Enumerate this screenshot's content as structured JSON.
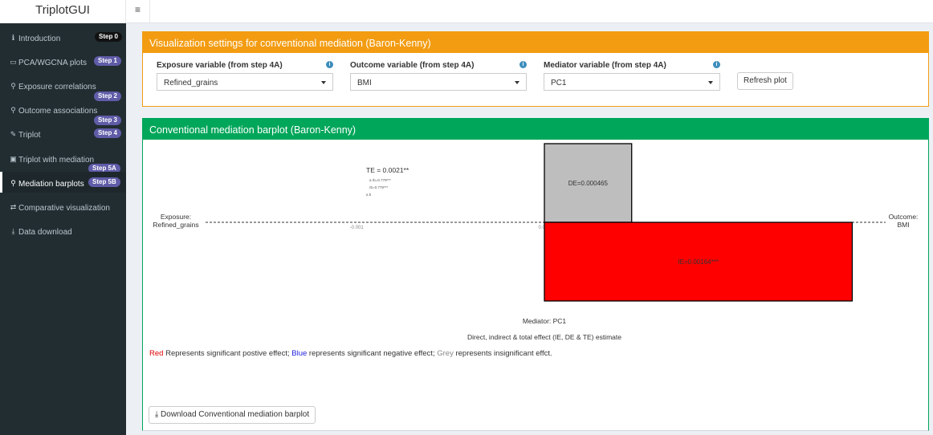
{
  "app": {
    "title": "TriplotGUI",
    "toggle_icon": "≡"
  },
  "sidebar": {
    "items": [
      {
        "label": "Introduction",
        "icon": "ℹ",
        "badges": [
          "Step 0"
        ],
        "active": false
      },
      {
        "label": "PCA/WGCNA plots",
        "icon": "▭",
        "badges": [
          "Step 1"
        ],
        "active": false
      },
      {
        "label": "Exposure correlations",
        "icon": "⚲",
        "badges": [
          "Step 2"
        ],
        "active": false
      },
      {
        "label": "Outcome associations",
        "icon": "⚲",
        "badges": [
          "Step 3"
        ],
        "active": false
      },
      {
        "label": "Triplot",
        "icon": "✎",
        "badges": [
          "Step 4"
        ],
        "active": false
      },
      {
        "label": "Triplot with mediation",
        "icon": "▣",
        "badges": [
          "Step 5A"
        ],
        "active": false
      },
      {
        "label": "Mediation barplots",
        "icon": "⚲",
        "badges": [
          "Step 5B"
        ],
        "active": true
      },
      {
        "label": "Comparative visualization",
        "icon": "⇄",
        "badges": [],
        "active": false
      },
      {
        "label": "Data download",
        "icon": "⤓",
        "badges": [],
        "active": false
      }
    ]
  },
  "settings": {
    "title": "Visualization settings for conventional mediation (Baron-Kenny)",
    "exposure": {
      "label": "Exposure variable (from step 4A)",
      "value": "Refined_grains"
    },
    "outcome": {
      "label": "Outcome variable (from step 4A)",
      "value": "BMI"
    },
    "mediator": {
      "label": "Mediator variable (from step 4A)",
      "value": "PC1"
    },
    "refresh_label": "Refresh plot",
    "info_icon": "i"
  },
  "barplot": {
    "title": "Conventional mediation barplot (Baron-Kenny)",
    "legend": {
      "red": "Red",
      "red_text": " Represents significant postive effect; ",
      "blue": "Blue",
      "blue_text": " represents significant negative effect; ",
      "grey": "Grey",
      "grey_text": " represents insignificant effct."
    },
    "download_label": "Download Conventional mediation barplot",
    "download_icon": "⤓"
  },
  "chart_data": {
    "type": "bar",
    "exposure_label": [
      "Exposure:",
      "Refined_grains"
    ],
    "outcome_label": [
      "Outcome:",
      "BMI"
    ],
    "mediator_label": "Mediator: PC1",
    "xlabel": "Direct, indirect & total effect (IE, DE & TE) estimate",
    "x_ticks": [
      {
        "value": -0.001,
        "label": "-0.001"
      },
      {
        "value": 0,
        "label": "0.000"
      },
      {
        "value": 0.001,
        "label": "0.001"
      }
    ],
    "bars": [
      {
        "name": "DE",
        "start": 0,
        "end": 0.000465,
        "label": "DE=0.000465",
        "color": "#bebebe",
        "side": "above"
      },
      {
        "name": "IE",
        "start": 0,
        "end": 0.00164,
        "label": "IE=0.00164***",
        "color": "#ff0000",
        "side": "below"
      }
    ],
    "annotations": {
      "te": "TE  = 0.0021**",
      "small_lines": [
        "a\nrb=0.779***",
        "rb=0.779***",
        "a  b"
      ]
    },
    "colors": {
      "significant_positive": "#ff0000",
      "significant_negative": "#0000ff",
      "insignificant": "#bebebe"
    }
  }
}
